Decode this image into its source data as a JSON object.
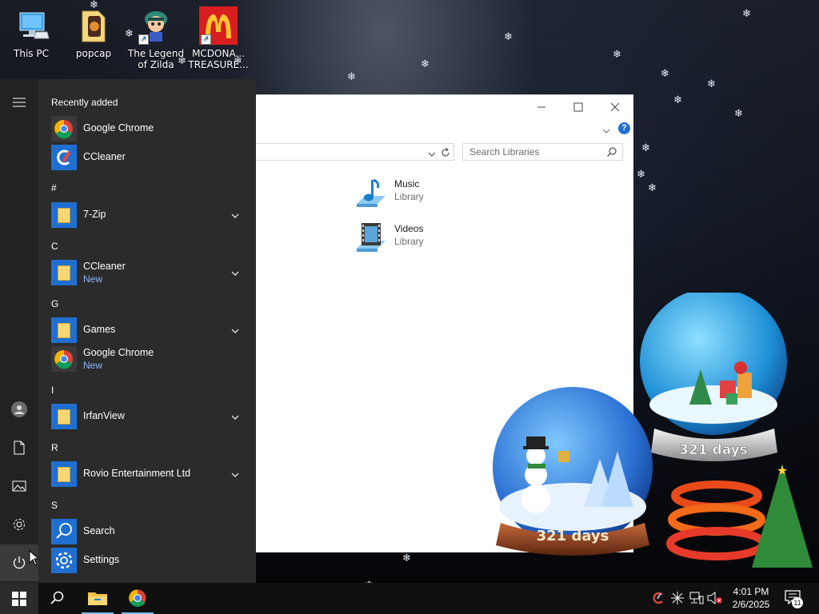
{
  "desktop": {
    "icons": [
      {
        "label": "This PC"
      },
      {
        "label": "popcap"
      },
      {
        "label": "The Legend of Zilda"
      },
      {
        "label": "MCDONA... TREASURE..."
      }
    ],
    "globe_text_1": "321 days",
    "globe_text_2": "321 days"
  },
  "explorer": {
    "search_placeholder": "Search Libraries",
    "libraries": [
      {
        "name": "Music",
        "type": "Library",
        "icon": "music-library-icon"
      },
      {
        "name": "Videos",
        "type": "Library",
        "icon": "videos-library-icon"
      }
    ]
  },
  "start_menu": {
    "recently_added_heading": "Recently added",
    "recent": [
      {
        "label": "Google Chrome",
        "icon": "chrome-icon"
      },
      {
        "label": "CCleaner",
        "icon": "ccleaner-icon"
      }
    ],
    "sections": [
      {
        "letter": "#",
        "apps": [
          {
            "label": "7-Zip",
            "new": "",
            "expandable": true
          }
        ]
      },
      {
        "letter": "C",
        "apps": [
          {
            "label": "CCleaner",
            "new": "New",
            "expandable": true
          }
        ]
      },
      {
        "letter": "G",
        "apps": [
          {
            "label": "Games",
            "new": "",
            "expandable": true
          },
          {
            "label": "Google Chrome",
            "new": "New",
            "expandable": false
          }
        ]
      },
      {
        "letter": "I",
        "apps": [
          {
            "label": "IrfanView",
            "new": "",
            "expandable": true
          }
        ]
      },
      {
        "letter": "R",
        "apps": [
          {
            "label": "Rovio Entertainment Ltd",
            "new": "",
            "expandable": true
          }
        ]
      },
      {
        "letter": "S",
        "apps": [
          {
            "label": "Search",
            "new": "",
            "expandable": false
          },
          {
            "label": "Settings",
            "new": "",
            "expandable": false
          }
        ]
      }
    ],
    "rail_icons": [
      "hamburger-icon",
      "user-icon",
      "documents-icon",
      "pictures-icon",
      "settings-icon",
      "power-icon"
    ]
  },
  "taskbar": {
    "time": "4:01 PM",
    "date": "2/6/2025",
    "notification_count": "11"
  },
  "colors": {
    "accent": "#1f6fd1",
    "start_bg": "#2b2b2b",
    "taskbar_bg": "#101010"
  }
}
